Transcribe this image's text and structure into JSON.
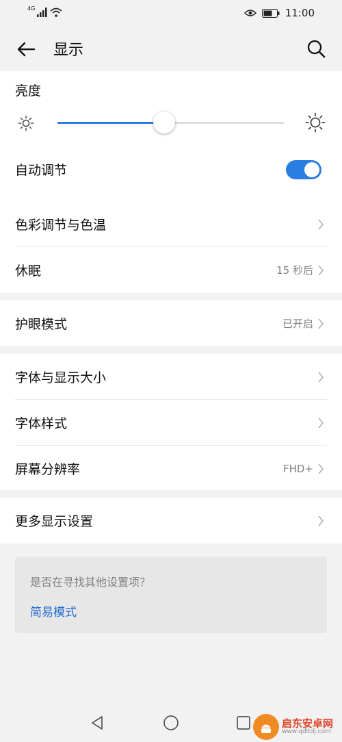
{
  "status_bar": {
    "network": "4G",
    "time": "11:00"
  },
  "app_bar": {
    "title": "显示"
  },
  "brightness": {
    "label": "亮度",
    "level_fraction": 0.47,
    "auto_label": "自动调节",
    "auto_on": true
  },
  "rows": {
    "color_temp": {
      "label": "色彩调节与色温",
      "value": ""
    },
    "sleep": {
      "label": "休眠",
      "value": "15 秒后"
    },
    "eye_comfort": {
      "label": "护眼模式",
      "value": "已开启"
    },
    "font_size": {
      "label": "字体与显示大小",
      "value": ""
    },
    "font_style": {
      "label": "字体样式",
      "value": ""
    },
    "resolution": {
      "label": "屏幕分辨率",
      "value": "FHD+"
    },
    "more": {
      "label": "更多显示设置",
      "value": ""
    }
  },
  "hint": {
    "question": "是否在寻找其他设置项？",
    "link": "简易模式"
  },
  "watermark": {
    "title": "启东安卓网",
    "url": "www.qdltdj.com"
  },
  "colors": {
    "accent": "#2a7de1",
    "link": "#1e6dd1",
    "background": "#f2f2f2"
  }
}
